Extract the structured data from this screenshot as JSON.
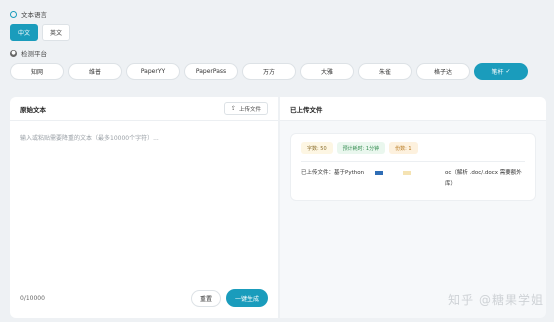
{
  "language": {
    "section_label": "文本语言",
    "options": [
      "中文",
      "英文"
    ],
    "selected": "中文"
  },
  "platform": {
    "section_label": "检测平台",
    "options": [
      "知网",
      "维普",
      "PaperYY",
      "PaperPass",
      "万方",
      "大雅",
      "朱雀",
      "格子达",
      "笔杆"
    ],
    "selected": "笔杆",
    "selected_check": "✓"
  },
  "source": {
    "title": "原始文本",
    "upload_label": "上传文件",
    "placeholder": "输入或粘贴需要降重的文本（最多10000个字符）...",
    "counter": "0/10000",
    "reset_label": "重置",
    "generate_label": "一键生成"
  },
  "uploaded": {
    "title": "已上传文件",
    "badges": {
      "words": "字数: 50",
      "time": "预计耗时: 1分钟",
      "pages": "份数: 1"
    },
    "file_prefix": "已上传文件：基于Python",
    "file_suffix": "oc（解析 .doc/.docx 需要额外库）",
    "file_suffix_line2": "外库)"
  },
  "watermark": "知乎 @糖果学姐",
  "colors": {
    "accent": "#1a9cbc"
  }
}
